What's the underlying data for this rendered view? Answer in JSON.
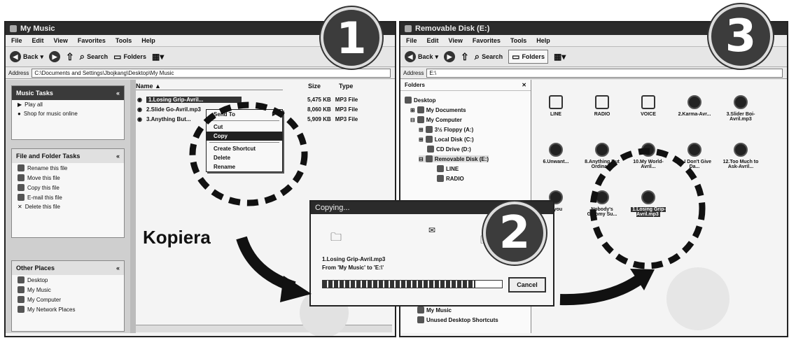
{
  "left": {
    "title": "My Music",
    "menu": [
      "File",
      "Edit",
      "View",
      "Favorites",
      "Tools",
      "Help"
    ],
    "toolbar": {
      "back": "Back",
      "search": "Search",
      "folders": "Folders"
    },
    "address_label": "Address",
    "address": "C:\\Documents and Settings\\Jbojkang\\Desktop\\My Music",
    "cols": {
      "name": "Name",
      "size": "Size",
      "type": "Type"
    },
    "files": [
      {
        "name": "1.Losing Grip-Avril...",
        "size": "5,475 KB",
        "type": "MP3 File"
      },
      {
        "name": "2.Slide Go-Avril.mp3",
        "size": "8,060 KB",
        "type": "MP3 File"
      },
      {
        "name": "3.Anything But...",
        "size": "5,909 KB",
        "type": "MP3 File"
      }
    ],
    "music_tasks": {
      "title": "Music Tasks",
      "items": [
        "Play all",
        "Shop for music online"
      ]
    },
    "file_tasks": {
      "title": "File and Folder Tasks",
      "items": [
        "Rename this file",
        "Move this file",
        "Copy this file",
        "E-mail this file",
        "Delete this file"
      ]
    },
    "other_places": {
      "title": "Other Places",
      "items": [
        "Desktop",
        "My Music",
        "My Computer",
        "My Network Places"
      ]
    },
    "context_menu": [
      "Send To",
      "Cut",
      "Copy",
      "Create Shortcut",
      "Delete",
      "Rename"
    ]
  },
  "right": {
    "title": "Removable Disk (E:)",
    "menu": [
      "File",
      "Edit",
      "View",
      "Favorites",
      "Tools",
      "Help"
    ],
    "toolbar": {
      "back": "Back",
      "search": "Search",
      "folders": "Folders"
    },
    "address_label": "Address",
    "address": "E:\\",
    "folders_title": "Folders",
    "tree": [
      "Desktop",
      "My Documents",
      "My Computer",
      "3½ Floppy (A:)",
      "Local Disk (C:)",
      "CD Drive (D:)",
      "Removable Disk (E:)",
      "LINE",
      "RADIO",
      "My Music",
      "Unused Desktop Shortcuts"
    ],
    "tiles": [
      {
        "label": "LINE",
        "kind": "folder"
      },
      {
        "label": "RADIO",
        "kind": "folder"
      },
      {
        "label": "VOICE",
        "kind": "folder"
      },
      {
        "label": "2.Karma-Avr...",
        "kind": "mp3"
      },
      {
        "label": "3.Slider Boi-Avril.mp3",
        "kind": "mp3"
      },
      {
        "label": "6.Unwant...",
        "kind": "mp3"
      },
      {
        "label": "8.Anything But Ordinar...",
        "kind": "mp3"
      },
      {
        "label": "10.My World-Avril...",
        "kind": "mp3"
      },
      {
        "label": "11.I Don't Give Da...",
        "kind": "mp3"
      },
      {
        "label": "12.Too Much to Ask-Avril...",
        "kind": "mp3"
      },
      {
        "label": "...you",
        "kind": "mp3"
      },
      {
        "label": "Nobody's Gloomy Su...",
        "kind": "mp3"
      },
      {
        "label": "1.Losing Grip-Avril.mp3",
        "kind": "mp3"
      }
    ]
  },
  "copy_dialog": {
    "title": "Copying...",
    "file": "1.Losing Grip-Avril.mp3",
    "from_to": "From 'My Music' to 'E:\\'",
    "cancel": "Cancel",
    "progress": 0.85
  },
  "annotations": {
    "step1": "1",
    "step2": "2",
    "step3": "3",
    "kopiera": "Kopiera"
  }
}
